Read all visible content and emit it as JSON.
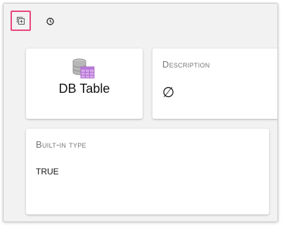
{
  "toolbar": {
    "add_icon": "add-square-icon",
    "history_icon": "clock-icon",
    "highlight_color": "#e8457a"
  },
  "type_card": {
    "icon": "database-table-icon",
    "type_name": "DB Table"
  },
  "description_card": {
    "heading": "Description",
    "value": "∅"
  },
  "builtin_card": {
    "heading": "Built-in type",
    "value": "TRUE"
  }
}
